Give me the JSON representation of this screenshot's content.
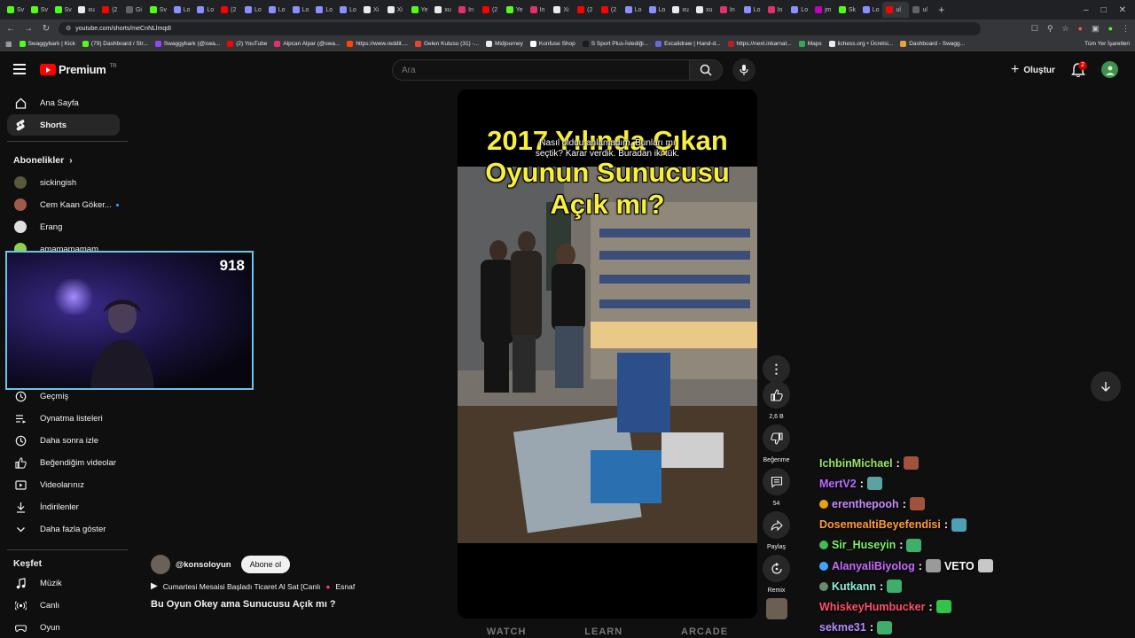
{
  "browser": {
    "tabs": [
      {
        "label": "Sv",
        "color": "#53fc18"
      },
      {
        "label": "Sv",
        "color": "#53fc18"
      },
      {
        "label": "Sv",
        "color": "#53fc18"
      },
      {
        "label": "xu",
        "color": "#e8eaed"
      },
      {
        "label": "(2",
        "color": "#ff0000"
      },
      {
        "label": "Gi",
        "color": "#5f6368"
      },
      {
        "label": "Sv",
        "color": "#53fc18"
      },
      {
        "label": "Lo",
        "color": "#8a8fff"
      },
      {
        "label": "Lo",
        "color": "#8a8fff"
      },
      {
        "label": "(2",
        "color": "#ff0000"
      },
      {
        "label": "Lo",
        "color": "#8a8fff"
      },
      {
        "label": "Lo",
        "color": "#8a8fff"
      },
      {
        "label": "Lo",
        "color": "#8a8fff"
      },
      {
        "label": "Lo",
        "color": "#8a8fff"
      },
      {
        "label": "Lo",
        "color": "#8a8fff"
      },
      {
        "label": "Xi",
        "color": "#e8eaed"
      },
      {
        "label": "Xi",
        "color": "#e8eaed"
      },
      {
        "label": "Ye",
        "color": "#53fc18"
      },
      {
        "label": "xu",
        "color": "#e8eaed"
      },
      {
        "label": "In",
        "color": "#e1306c"
      },
      {
        "label": "(2",
        "color": "#ff0000"
      },
      {
        "label": "Ye",
        "color": "#53fc18"
      },
      {
        "label": "In",
        "color": "#e1306c"
      },
      {
        "label": "Xi",
        "color": "#e8eaed"
      },
      {
        "label": "(2",
        "color": "#ff0000"
      },
      {
        "label": "(2",
        "color": "#ff0000"
      },
      {
        "label": "Lo",
        "color": "#8a8fff"
      },
      {
        "label": "Lo",
        "color": "#8a8fff"
      },
      {
        "label": "xu",
        "color": "#e8eaed"
      },
      {
        "label": "xu",
        "color": "#e8eaed"
      },
      {
        "label": "In",
        "color": "#e1306c"
      },
      {
        "label": "Lo",
        "color": "#8a8fff"
      },
      {
        "label": "In",
        "color": "#e1306c"
      },
      {
        "label": "Lo",
        "color": "#8a8fff"
      },
      {
        "label": "jm",
        "color": "#c000c0"
      },
      {
        "label": "Sk",
        "color": "#53fc18"
      },
      {
        "label": "Lo",
        "color": "#8a8fff"
      },
      {
        "label": "ul",
        "color": "#ff0000"
      },
      {
        "label": "ul",
        "color": "#5f6368"
      }
    ],
    "url": "youtube.com/shorts/meCnNLlmqdI",
    "bookmarks": [
      {
        "label": "Swaggybark | Kick",
        "color": "#53fc18"
      },
      {
        "label": "(79) Dashboard / Str...",
        "color": "#53fc18"
      },
      {
        "label": "Swaggybark (@swa...",
        "color": "#9146ff"
      },
      {
        "label": "(2) YouTube",
        "color": "#ff0000"
      },
      {
        "label": "Alpcan Alpar (@swa...",
        "color": "#e1306c"
      },
      {
        "label": "https://www.reddit....",
        "color": "#ff4500"
      },
      {
        "label": "Gelen Kutusu (31) -...",
        "color": "#ea4335"
      },
      {
        "label": "Midjourney",
        "color": "#e8eaed"
      },
      {
        "label": "Konfuse Shop",
        "color": "#ffffff"
      },
      {
        "label": "S Sport Plus-İstediği...",
        "color": "#1a1a1a"
      },
      {
        "label": "Excalidraw | Hand-d...",
        "color": "#6965db"
      },
      {
        "label": "https://next.inkarnat...",
        "color": "#b22222"
      },
      {
        "label": "Maps",
        "color": "#34a853"
      },
      {
        "label": "lichess.org • Ücretsi...",
        "color": "#e8eaed"
      },
      {
        "label": "Dashboard - Swagg...",
        "color": "#e8a33d"
      }
    ],
    "bookmarks_right": "Tüm Yer İşaretleri"
  },
  "header": {
    "logo_text": "Premium",
    "logo_sup": "TR",
    "search_placeholder": "Ara",
    "create_label": "Oluştur",
    "notif_count": "2"
  },
  "sidebar": {
    "home": "Ana Sayfa",
    "shorts": "Shorts",
    "subs_heading": "Abonelikler",
    "subs": [
      {
        "name": "sickingish",
        "color": "#5a5a3a"
      },
      {
        "name": "Cem Kaan Göker...",
        "color": "#a05a4a"
      },
      {
        "name": "Erang",
        "color": "#e0e0e0"
      },
      {
        "name": "amamamamam",
        "color": "#8fd14f"
      }
    ],
    "you": [
      {
        "label": "Geçmiş"
      },
      {
        "label": "Oynatma listeleri"
      },
      {
        "label": "Daha sonra izle"
      },
      {
        "label": "Beğendiğim videolar"
      },
      {
        "label": "Videolarınız"
      },
      {
        "label": "İndirilenler"
      },
      {
        "label": "Daha fazla göster"
      }
    ],
    "explore_heading": "Keşfet",
    "explore": [
      {
        "label": "Müzik"
      },
      {
        "label": "Canlı"
      },
      {
        "label": "Oyun"
      }
    ]
  },
  "webcam": {
    "viewer_count": "918"
  },
  "short": {
    "title_line1": "2017 Yılında Çıkan",
    "title_line2": "Oyunun Sunucusu",
    "title_line3": "Açık mı?",
    "subtitle_line1": "Nasıl olduu anlamadım. Bunları mı",
    "subtitle_line2": "seçtik? Karar verdik. Buradan iki tük.",
    "channel": "@konsoloyun",
    "subscribe": "Abone ol",
    "live_text": "Cumartesi Mesaisi Başladı Ticaret Al Sat [Canlı",
    "live_tail": "Esnaf",
    "caption": "Bu Oyun Okey ama Sunucusu Açık mı ?",
    "bottom_words": [
      "WATCH",
      "LEARN",
      "ARCADE"
    ]
  },
  "actions": {
    "like_count": "2,6 B",
    "dislike_label": "Beğenme",
    "comment_count": "54",
    "share_label": "Paylaş",
    "remix_label": "Remix"
  },
  "chat": [
    {
      "user": "IchbinMichael",
      "color": "#9be36a",
      "msg": "",
      "badge": ""
    },
    {
      "user": "MertV2",
      "color": "#b86bff",
      "msg": "",
      "badge": ""
    },
    {
      "user": "erenthepooh",
      "color": "#c78bff",
      "msg": "",
      "badge": "#e8a30f"
    },
    {
      "user": "DosemealtiBeyefendisi",
      "color": "#ff9b3d",
      "msg": "",
      "badge": ""
    },
    {
      "user": "Sir_Huseyin",
      "color": "#7cf06a",
      "msg": "",
      "badge": "#43b95a"
    },
    {
      "user": "AlanyaliBiyolog",
      "color": "#c66bff",
      "msg": "VETO",
      "badge": "#3ea6ff"
    },
    {
      "user": "Kutkann",
      "color": "#8af0d8",
      "msg": "",
      "badge": "#6b8a6b"
    },
    {
      "user": "WhiskeyHumbucker",
      "color": "#ff4f6a",
      "msg": "",
      "badge": ""
    },
    {
      "user": "sekme31",
      "color": "#b88bff",
      "msg": "",
      "badge": ""
    }
  ]
}
